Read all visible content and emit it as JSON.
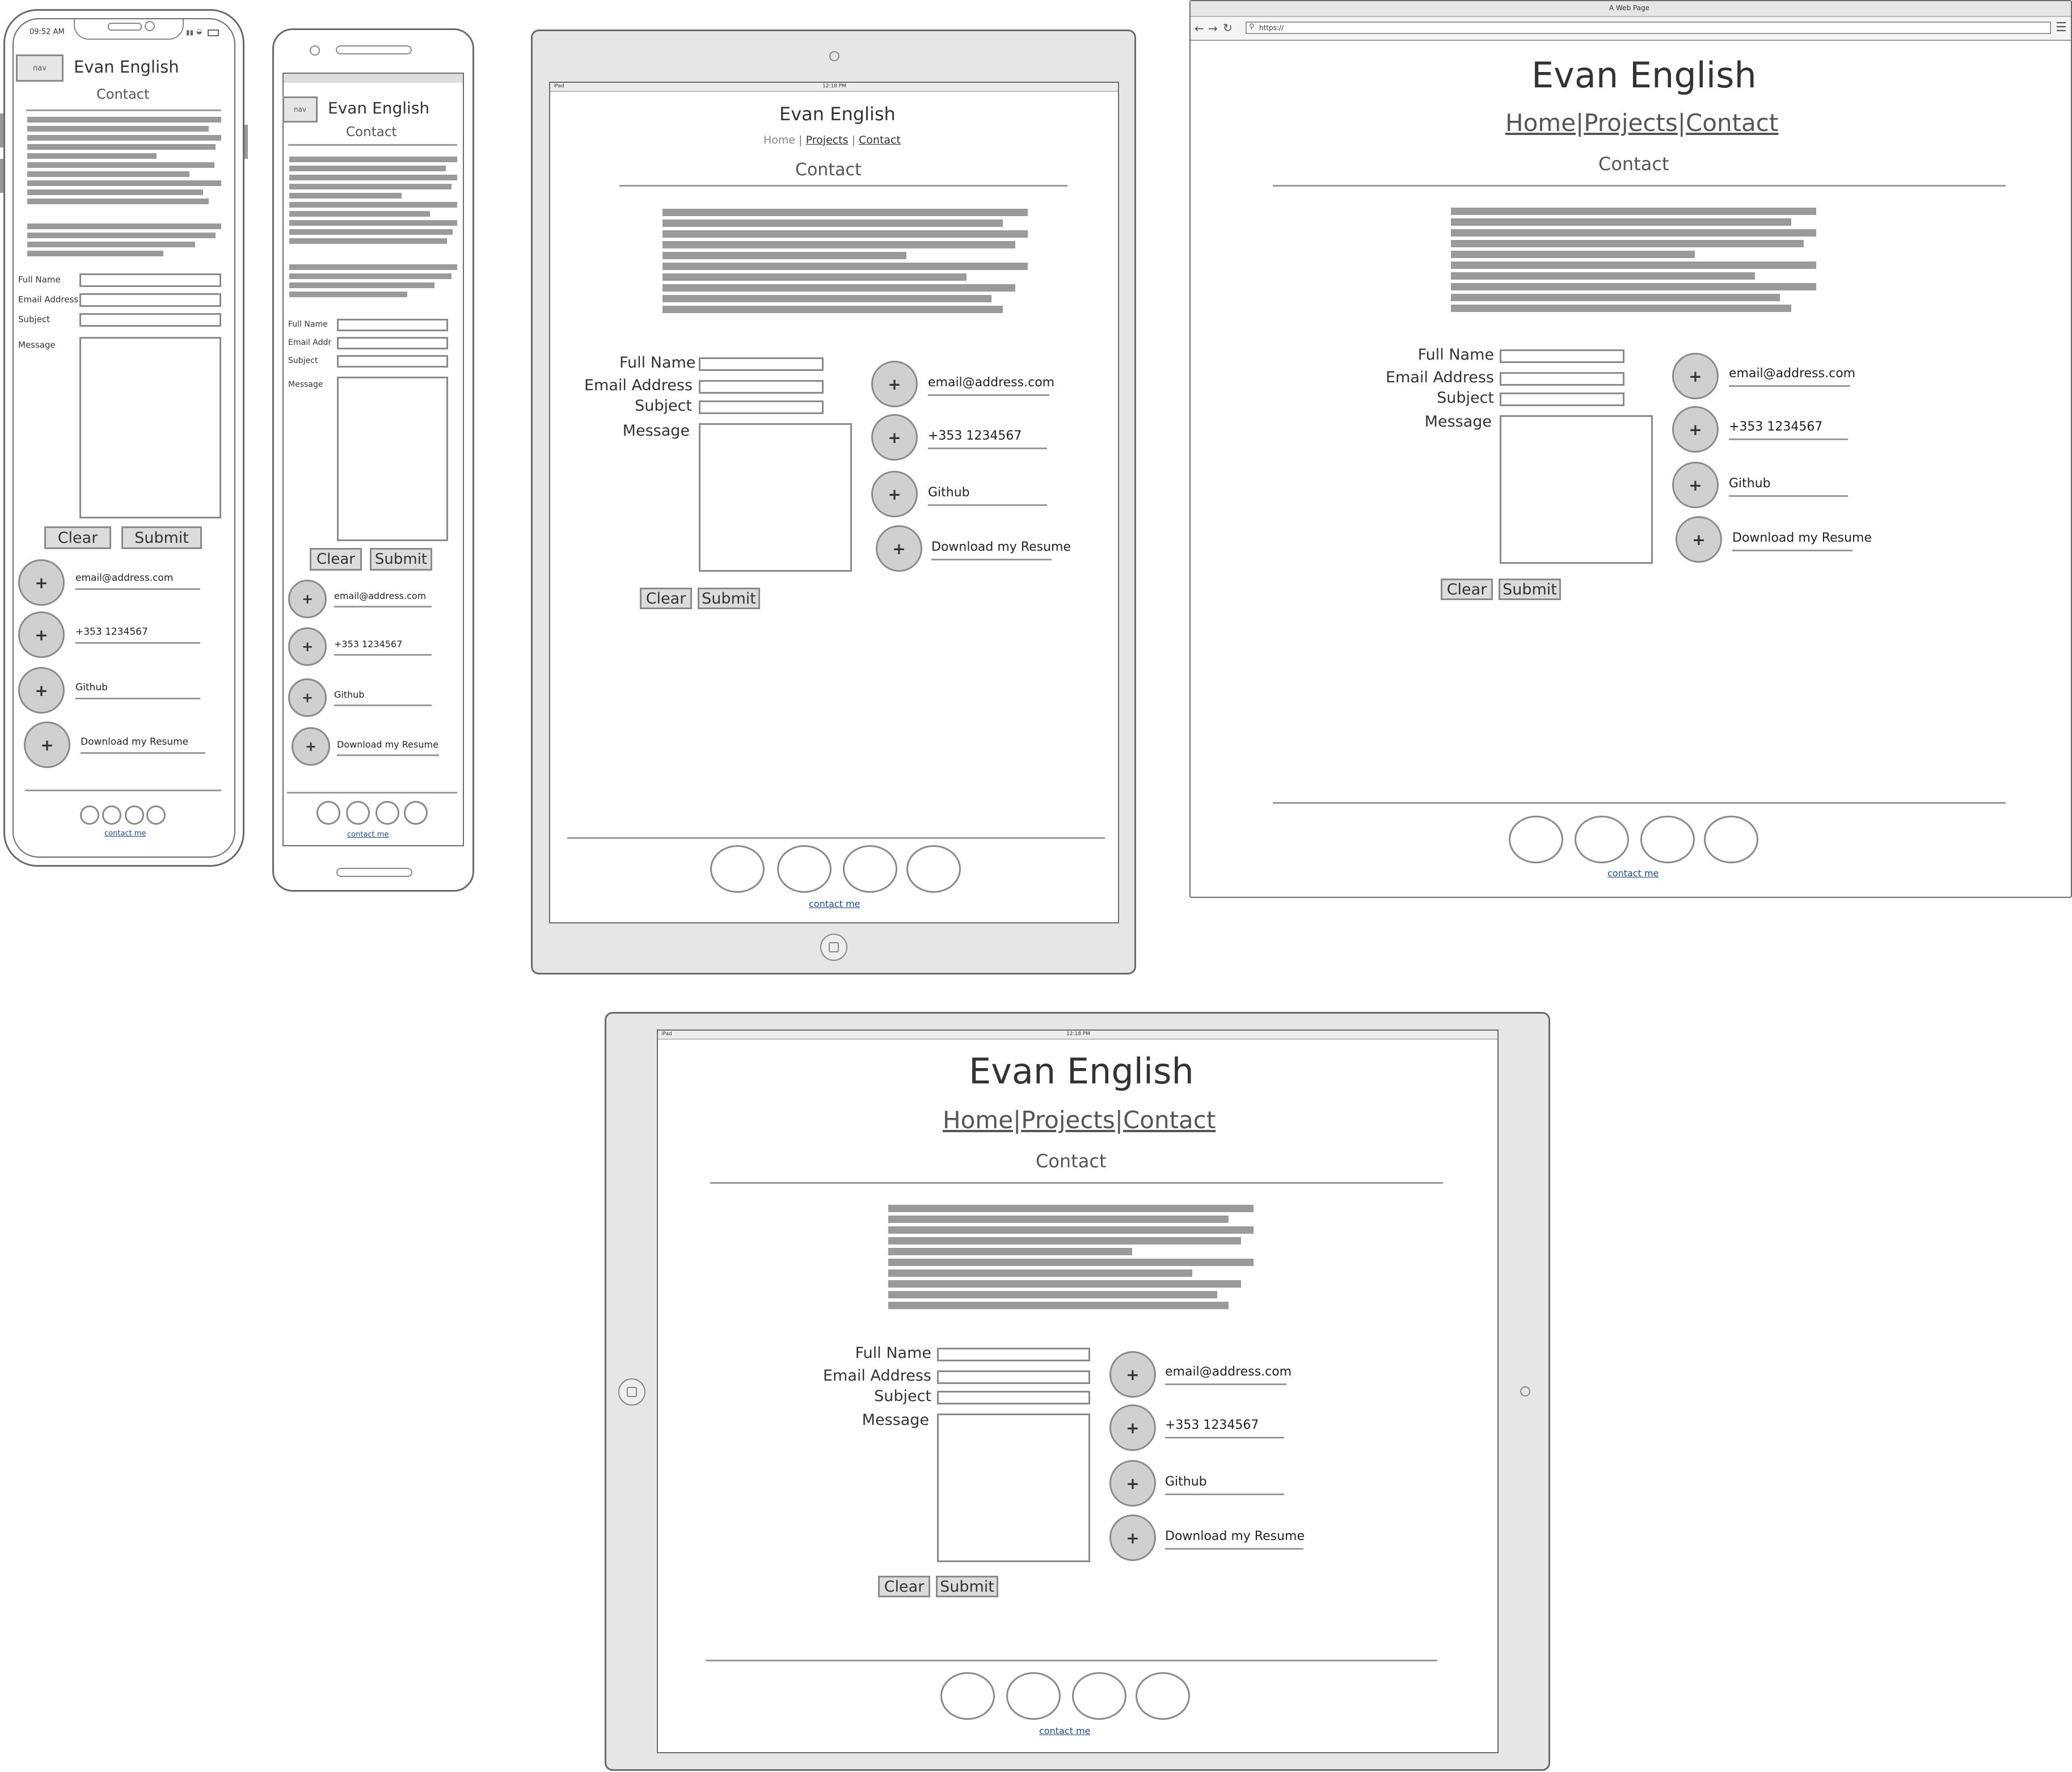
{
  "site": {
    "title": "Evan English",
    "page_heading": "Contact",
    "nav_box": "nav",
    "nav": [
      "Home",
      "Projects",
      "Contact"
    ],
    "separator": "|",
    "form": {
      "full_name": "Full Name",
      "email_address": "Email Address",
      "email_address_short": "Email Addr",
      "subject": "Subject",
      "message": "Message",
      "clear": "Clear",
      "submit": "Submit"
    },
    "contact_items": [
      {
        "icon": "plus-icon",
        "label": "email@address.com"
      },
      {
        "icon": "plus-icon",
        "label": "+353 1234567"
      },
      {
        "icon": "plus-icon",
        "label": "Github"
      },
      {
        "icon": "plus-icon",
        "label": "Download my Resume"
      }
    ],
    "plus": "+",
    "footer_link": "contact me"
  },
  "device_status": {
    "phone_time": "09:52 AM",
    "ipad_label": "iPad",
    "ipad_time": "12:18 PM"
  },
  "browser": {
    "window_title": "A Web Page",
    "url": "https://"
  },
  "text_placeholder": {
    "color": "#9a9a9a",
    "paragraph_lines": [
      1.0,
      0.93,
      0.97,
      0.95,
      0.73,
      0.97,
      0.88,
      0.97,
      0.92,
      0.93
    ]
  }
}
